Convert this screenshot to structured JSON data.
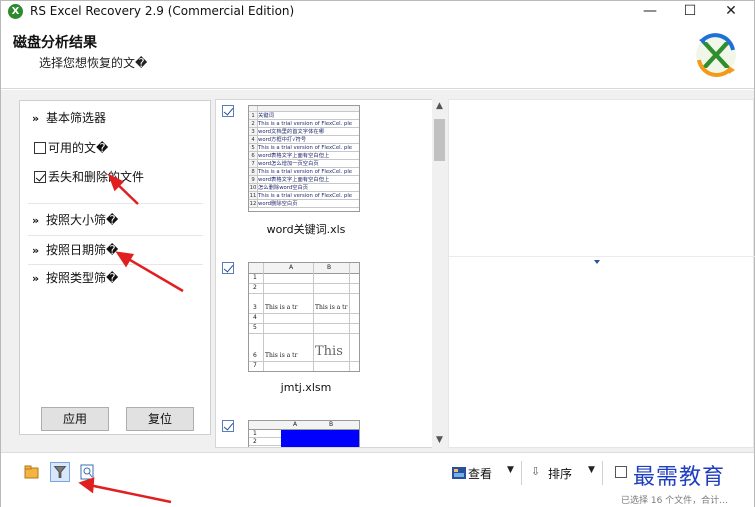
{
  "window": {
    "title": "RS Excel Recovery 2.9 (Commercial Edition)",
    "minimize": "—",
    "maximize": "☐",
    "close": "✕"
  },
  "header": {
    "title": "磁盘分析结果",
    "subtitle": "选择您想恢复的文�"
  },
  "filters": {
    "basic_label": "基本筛选器",
    "available_label": "可用的文�",
    "available_checked": false,
    "deleted_label": "丢失和删除的文件",
    "deleted_checked": true,
    "by_size_label": "按照大小筛�",
    "by_date_label": "按照日期筛�",
    "by_type_label": "按照类型筛�",
    "apply_button": "应用",
    "reset_button": "复位"
  },
  "thumbnails": [
    {
      "name": "word关键词.xls",
      "checked": true,
      "rows": [
        {
          "n": "1",
          "text": "关键词"
        },
        {
          "n": "2",
          "text": "This is a trial version of FlexCel. ple"
        },
        {
          "n": "3",
          "text": "word文档里的首文字体在哪"
        },
        {
          "n": "4",
          "text": "word方框中打√符号"
        },
        {
          "n": "5",
          "text": "This is a trial version of FlexCel. ple"
        },
        {
          "n": "6",
          "text": "word表格文字上面有空白但上"
        },
        {
          "n": "7",
          "text": "word怎么增加一页空白页"
        },
        {
          "n": "8",
          "text": "This is a trial version of FlexCel. ple"
        },
        {
          "n": "9",
          "text": "word表格文字上面有空白但上"
        },
        {
          "n": "10",
          "text": "怎么删除word空白页"
        },
        {
          "n": "11",
          "text": "This is a trial version of FlexCel. ple"
        },
        {
          "n": "12",
          "text": "word删除空白页"
        }
      ]
    },
    {
      "name": "jmtj.xlsm",
      "checked": true,
      "cols": [
        "A",
        "B"
      ],
      "rows": [
        {
          "n": "1",
          "a": "",
          "b": ""
        },
        {
          "n": "2",
          "a": "",
          "b": ""
        },
        {
          "n": "3",
          "a": "This is a tr",
          "b": "This is a tr"
        },
        {
          "n": "4",
          "a": "",
          "b": ""
        },
        {
          "n": "5",
          "a": "",
          "b": ""
        },
        {
          "n": "6",
          "a": "This is a tr",
          "b": "This"
        },
        {
          "n": "7",
          "a": "",
          "b": ""
        }
      ]
    },
    {
      "name": "",
      "checked": true,
      "cols": [
        "A",
        "B"
      ]
    }
  ],
  "toolbar": {
    "view_label": "查看",
    "sort_label": "排序"
  },
  "status": {
    "text": "已选择 16 个文件，合计…"
  },
  "watermark": "最需教育",
  "colors": {
    "accent": "#2b4f9c",
    "annotation": "#e02020",
    "highlight_fill": "#0000ff"
  }
}
